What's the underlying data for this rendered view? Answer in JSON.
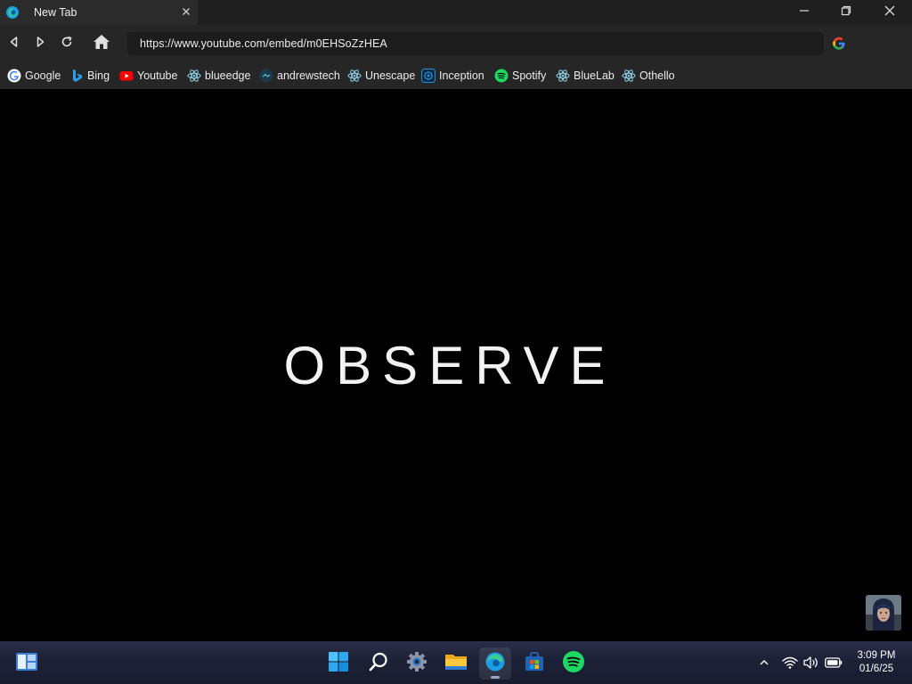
{
  "browser": {
    "tab": {
      "title": "New Tab",
      "favicon": "edge-icon"
    },
    "window_controls": [
      "minimize-icon",
      "restore-icon",
      "close-icon"
    ],
    "address_bar": {
      "url": "https://www.youtube.com/embed/m0EHSoZzHEA",
      "search_engine_icon": "google-icon"
    },
    "nav_icons": [
      "back-icon",
      "forward-icon",
      "reload-icon",
      "home-icon"
    ]
  },
  "bookmarks": [
    {
      "label": "Google",
      "icon": "google-icon"
    },
    {
      "label": "Bing",
      "icon": "bing-icon"
    },
    {
      "label": "Youtube",
      "icon": "youtube-icon"
    },
    {
      "label": "blueedge",
      "icon": "react-icon"
    },
    {
      "label": "andrewstech",
      "icon": "andrewstech-icon"
    },
    {
      "label": "Unescape",
      "icon": "react-icon"
    },
    {
      "label": "Inception",
      "icon": "inception-icon"
    },
    {
      "label": "Spotify",
      "icon": "spotify-icon"
    },
    {
      "label": "BlueLab",
      "icon": "react-icon"
    },
    {
      "label": "Othello",
      "icon": "react-icon"
    }
  ],
  "content": {
    "video_text": "OBSERVE"
  },
  "taskbar": {
    "apps": [
      "widgets-icon",
      "windows-start-icon",
      "search-icon",
      "settings-icon",
      "file-explorer-icon",
      "edge-icon",
      "store-icon",
      "spotify-icon"
    ],
    "active_app": "edge-icon",
    "tray": [
      "chevron-up-icon",
      "wifi-icon",
      "volume-icon",
      "battery-icon"
    ],
    "time": "3:09 PM",
    "date": "01/6/25"
  },
  "colors": {
    "titlebar": "#1f1f1f",
    "toolbar": "#262626",
    "address_bg": "#1c1c1c",
    "content_bg": "#000000",
    "spotify_green": "#1ed760",
    "youtube_red": "#ff0000",
    "react_teal": "#8fd3e8"
  }
}
